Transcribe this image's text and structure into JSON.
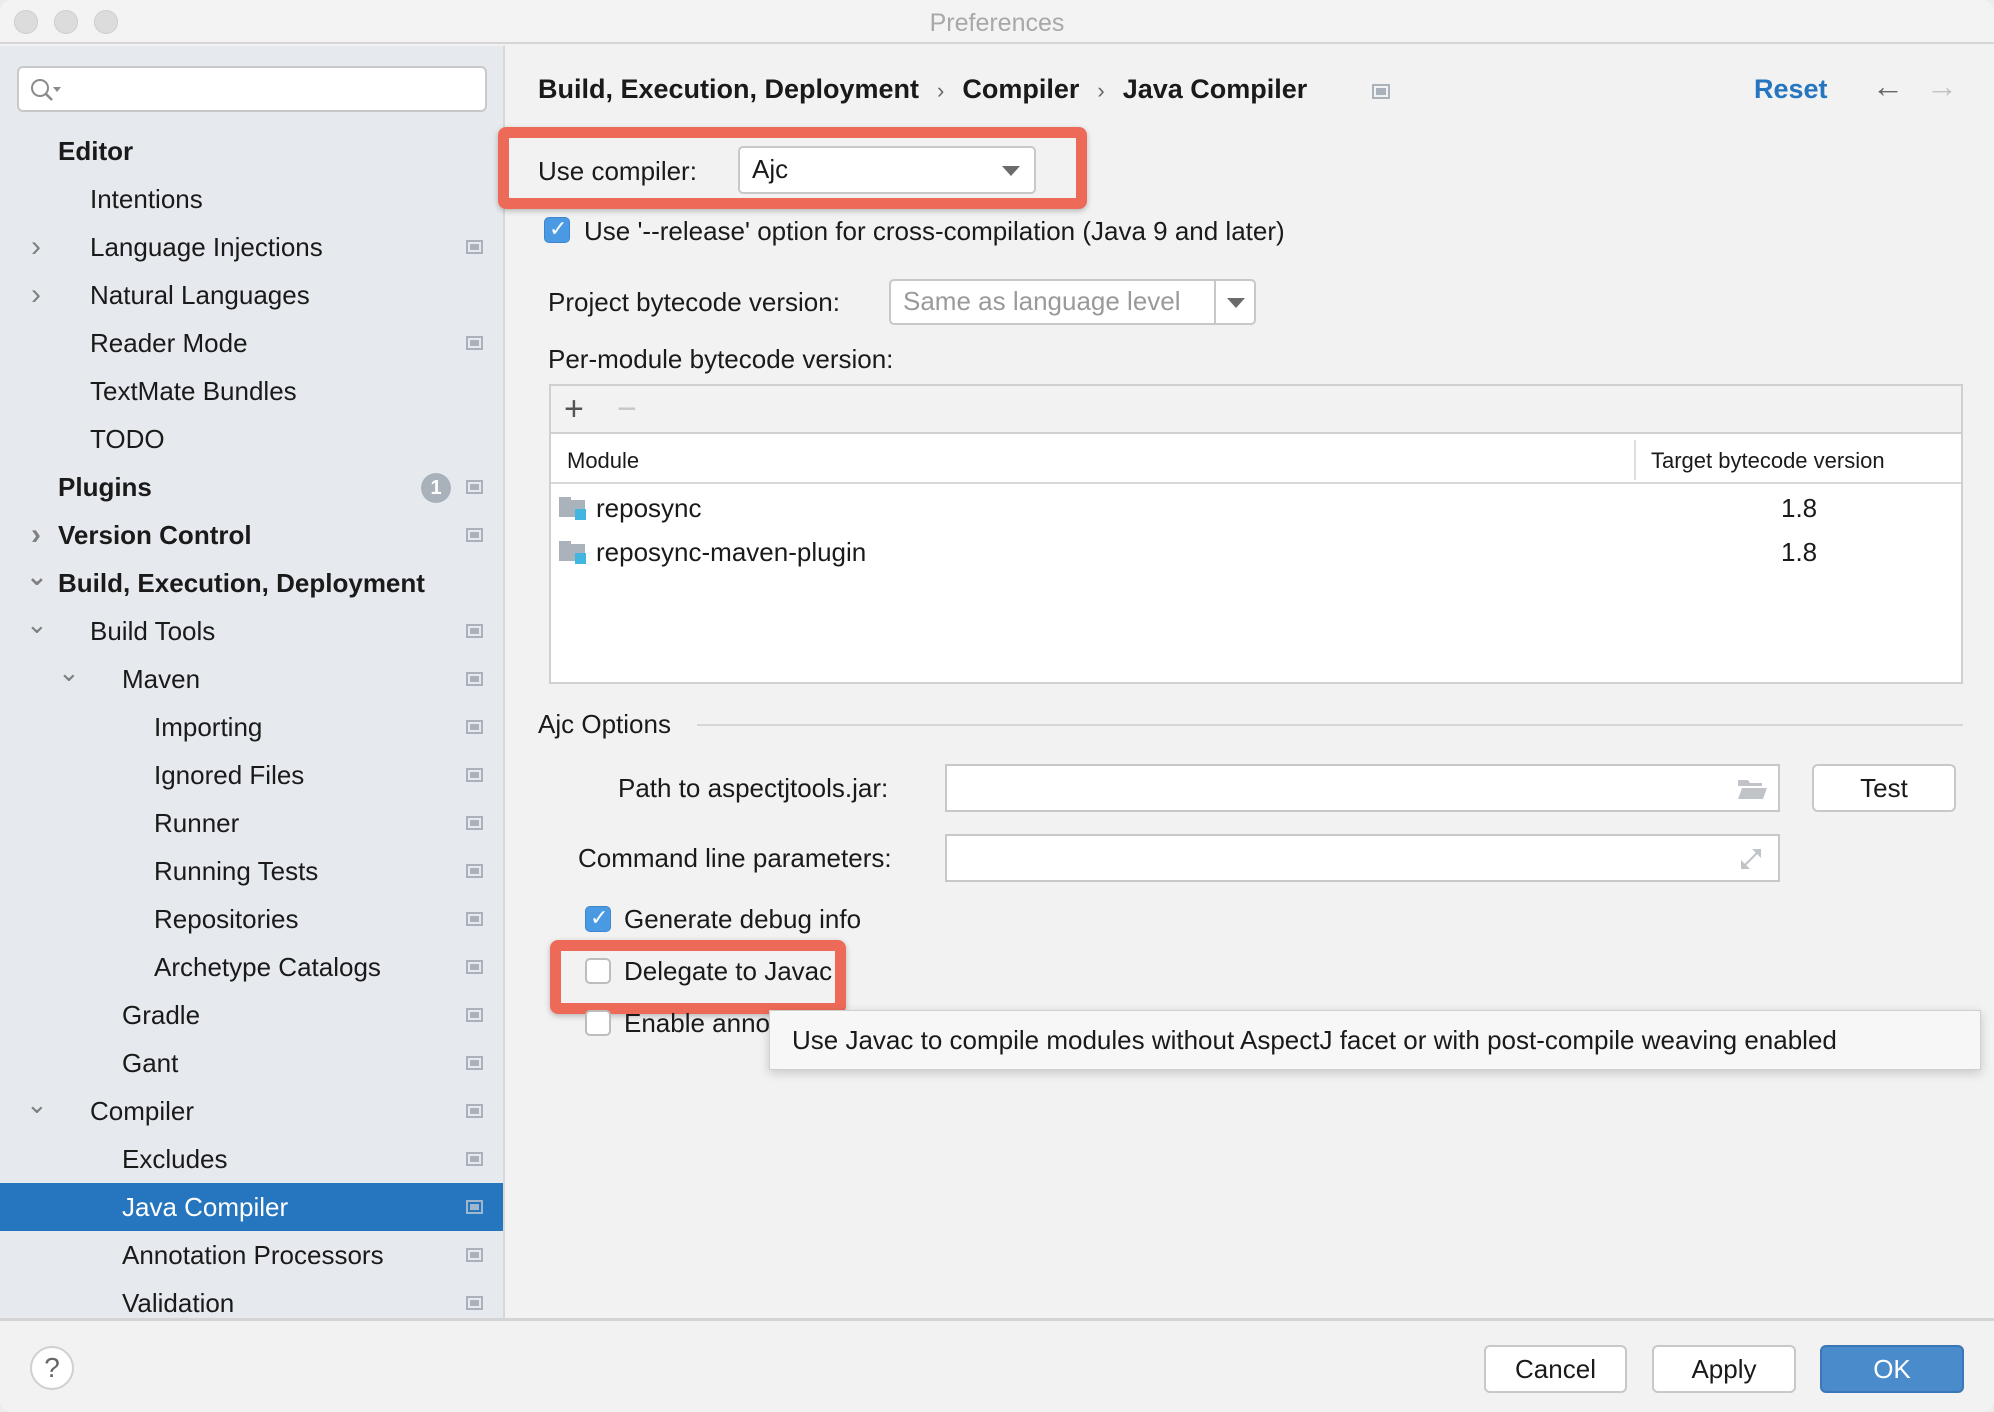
{
  "window": {
    "title": "Preferences"
  },
  "search": {
    "placeholder": ""
  },
  "sidebar": {
    "items": [
      {
        "label": "Editor",
        "bold": true,
        "level": 0,
        "chevron": "",
        "proj": false
      },
      {
        "label": "Intentions",
        "level": 1,
        "chevron": "",
        "proj": false
      },
      {
        "label": "Language Injections",
        "level": 1,
        "chevron": "right",
        "proj": true
      },
      {
        "label": "Natural Languages",
        "level": 1,
        "chevron": "right",
        "proj": false
      },
      {
        "label": "Reader Mode",
        "level": 1,
        "chevron": "",
        "proj": true
      },
      {
        "label": "TextMate Bundles",
        "level": 1,
        "chevron": "",
        "proj": false
      },
      {
        "label": "TODO",
        "level": 1,
        "chevron": "",
        "proj": false
      },
      {
        "label": "Plugins",
        "bold": true,
        "level": 0,
        "chevron": "",
        "proj": true,
        "badge": "1"
      },
      {
        "label": "Version Control",
        "bold": true,
        "level": 0,
        "chevron": "right",
        "proj": true
      },
      {
        "label": "Build, Execution, Deployment",
        "bold": true,
        "level": 0,
        "chevron": "down",
        "proj": false
      },
      {
        "label": "Build Tools",
        "level": 1,
        "chevron": "down",
        "proj": true
      },
      {
        "label": "Maven",
        "level": 2,
        "chevron": "down",
        "proj": true
      },
      {
        "label": "Importing",
        "level": 3,
        "chevron": "",
        "proj": true
      },
      {
        "label": "Ignored Files",
        "level": 3,
        "chevron": "",
        "proj": true
      },
      {
        "label": "Runner",
        "level": 3,
        "chevron": "",
        "proj": true
      },
      {
        "label": "Running Tests",
        "level": 3,
        "chevron": "",
        "proj": true
      },
      {
        "label": "Repositories",
        "level": 3,
        "chevron": "",
        "proj": true
      },
      {
        "label": "Archetype Catalogs",
        "level": 3,
        "chevron": "",
        "proj": true
      },
      {
        "label": "Gradle",
        "level": 2,
        "chevron": "",
        "proj": true
      },
      {
        "label": "Gant",
        "level": 2,
        "chevron": "",
        "proj": true
      },
      {
        "label": "Compiler",
        "level": 1,
        "chevron": "down",
        "proj": true
      },
      {
        "label": "Excludes",
        "level": 2,
        "chevron": "",
        "proj": true
      },
      {
        "label": "Java Compiler",
        "level": 2,
        "chevron": "",
        "proj": true,
        "selected": true
      },
      {
        "label": "Annotation Processors",
        "level": 2,
        "chevron": "",
        "proj": true
      },
      {
        "label": "Validation",
        "level": 2,
        "chevron": "",
        "proj": true
      }
    ]
  },
  "breadcrumb": [
    "Build, Execution, Deployment",
    "Compiler",
    "Java Compiler"
  ],
  "header": {
    "reset_label": "Reset",
    "back_icon": "arrow-left-icon",
    "forward_icon": "arrow-right-icon"
  },
  "compiler": {
    "label": "Use compiler:",
    "value": "Ajc"
  },
  "release_option": {
    "label": "Use '--release' option for cross-compilation (Java 9 and later)",
    "checked": true
  },
  "project_bytecode": {
    "label": "Project bytecode version:",
    "placeholder": "Same as language level"
  },
  "per_module": {
    "label": "Per-module bytecode version:",
    "add_label": "+",
    "remove_label": "−",
    "columns": [
      "Module",
      "Target bytecode version"
    ],
    "rows": [
      {
        "module": "reposync",
        "version": "1.8"
      },
      {
        "module": "reposync-maven-plugin",
        "version": "1.8"
      }
    ]
  },
  "ajc": {
    "title": "Ajc Options",
    "path_label": "Path to aspectjtools.jar:",
    "path_value": "",
    "test_label": "Test",
    "cmd_label": "Command line parameters:",
    "cmd_value": "",
    "debug": {
      "label": "Generate debug info",
      "checked": true
    },
    "delegate": {
      "label": "Delegate to Javac",
      "checked": false
    },
    "annotation": {
      "label": "Enable anno",
      "checked": false
    }
  },
  "tooltip": {
    "text": "Use Javac to compile modules without AspectJ facet or with post-compile weaving enabled"
  },
  "footer": {
    "help_label": "?",
    "cancel_label": "Cancel",
    "apply_label": "Apply",
    "ok_label": "OK"
  },
  "colors": {
    "accent": "#2675bf",
    "highlight": "#ee6a58",
    "primary_button": "#4a8bcc"
  }
}
